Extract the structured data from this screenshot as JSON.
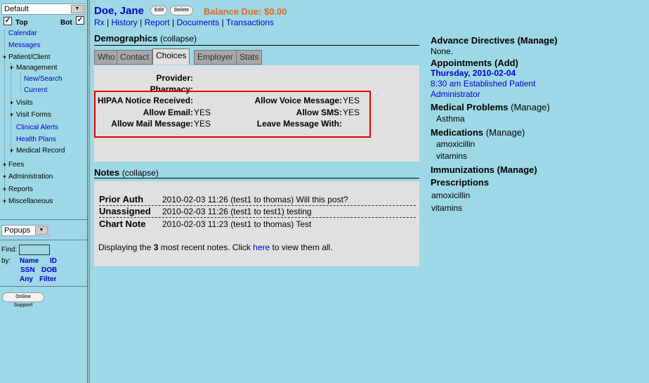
{
  "sidebar": {
    "layout_select": "Default",
    "top_label": "Top",
    "bot_label": "Bot",
    "top_checked": true,
    "bot_checked": true,
    "nav": {
      "calendar": "Calendar",
      "messages": "Messages",
      "patient_client": "Patient/Client",
      "management": "Management",
      "new_search": "New/Search",
      "current": "Current",
      "visits": "Visits",
      "visit_forms": "Visit Forms",
      "clinical_alerts": "Clinical Alerts",
      "health_plans": "Health Plans",
      "medical_record": "Medical Record",
      "fees": "Fees",
      "administration": "Administration",
      "reports": "Reports",
      "miscellaneous": "Miscellaneous"
    },
    "popups_select": "Popups",
    "find_label": "Find:",
    "by_label": "by:",
    "find_links": [
      "Name",
      "ID",
      "SSN",
      "DOB",
      "Any",
      "Filter"
    ],
    "online_support": "Online Support"
  },
  "header": {
    "patient_name": "Doe, Jane",
    "edit_label": "Edit",
    "delete_label": "Delete",
    "balance": "Balance Due: $0.00",
    "links": [
      "Rx",
      "History",
      "Report",
      "Documents",
      "Transactions"
    ]
  },
  "demographics": {
    "title": "Demographics",
    "collapse": "(collapse)",
    "tabs": [
      "Who",
      "Contact",
      "Choices",
      "Employer",
      "Stats"
    ],
    "active_tab": "Choices",
    "fields": {
      "provider_label": "Provider:",
      "pharmacy_label": "Pharmacy:",
      "hipaa_label": "HIPAA Notice Received:",
      "voice_label": "Allow Voice Message:",
      "voice_value": "YES",
      "email_label": "Allow Email:",
      "email_value": "YES",
      "sms_label": "Allow SMS:",
      "sms_value": "YES",
      "mail_label": "Allow Mail Message:",
      "mail_value": "YES",
      "leave_label": "Leave Message With:"
    }
  },
  "notes": {
    "title": "Notes",
    "collapse": "(collapse)",
    "rows": [
      {
        "type": "Prior Auth",
        "text": "2010-02-03 11:26 (test1 to thomas) Will this post?"
      },
      {
        "type": "Unassigned",
        "text": "2010-02-03 11:26 (test1 to test1) testing"
      },
      {
        "type": "Chart Note",
        "text": "2010-02-03 11:23 (test1 to thomas) Test"
      }
    ],
    "footer_pre": "Displaying the",
    "footer_count": "3",
    "footer_mid": "most recent notes. Click",
    "footer_link": "here",
    "footer_post": "to view them all."
  },
  "right": {
    "advance_directives": "Advance Directives",
    "advance_manage": "(Manage)",
    "advance_value": "None.",
    "appointments": "Appointments",
    "appointments_add": "(Add)",
    "appt_date": "Thursday, 2010-02-04",
    "appt_line1": "8:30 am Established Patient",
    "appt_line2": "Administrator",
    "medical_problems": "Medical Problems",
    "medical_manage": "(Manage)",
    "problems": [
      "Asthma"
    ],
    "medications": "Medications",
    "medications_manage": "(Manage)",
    "meds": [
      "amoxicillin",
      "vitamins"
    ],
    "immunizations": "Immunizations",
    "immunizations_manage": "(Manage)",
    "prescriptions": "Prescriptions",
    "rx": [
      "amoxicillin",
      "vitamins"
    ]
  }
}
